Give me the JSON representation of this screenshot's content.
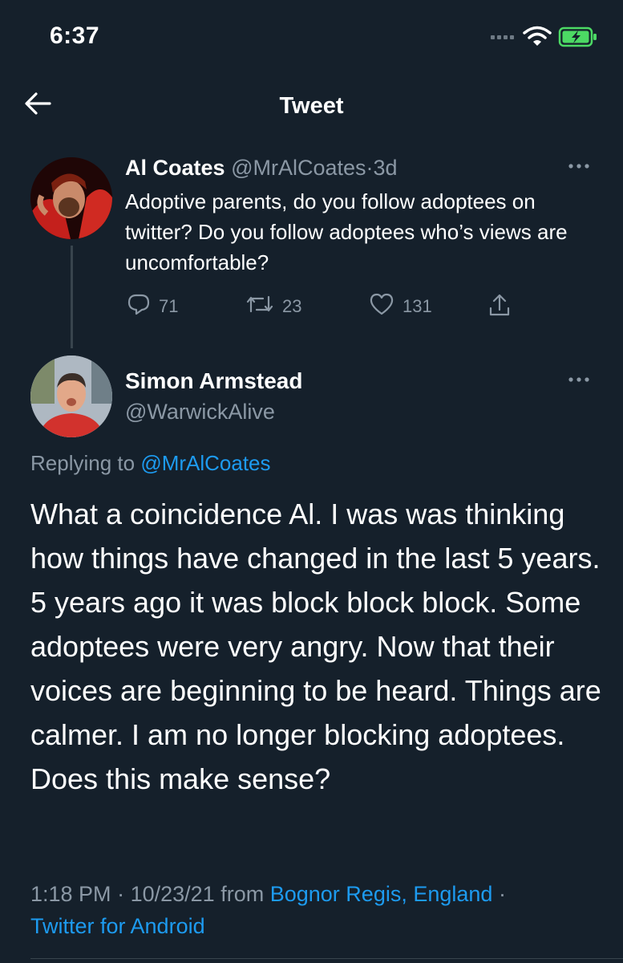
{
  "status_bar": {
    "time": "6:37"
  },
  "header": {
    "title": "Tweet"
  },
  "tweet_parent": {
    "name": "Al Coates",
    "handle": "@MrAlCoates",
    "separator": "·",
    "age": "3d",
    "text": "Adoptive parents, do you follow adoptees on twitter? Do you follow adoptees who’s views are uncomfortable?",
    "replies": "71",
    "retweets": "23",
    "likes": "131"
  },
  "tweet_main": {
    "name": "Simon Armstead",
    "handle": "@WarwickAlive",
    "replying_prefix": "Replying to",
    "replying_handle": "@MrAlCoates",
    "text": "What a coincidence Al. I was was thinking how things have changed in the last 5 years. 5 years ago it was block block block. Some adoptees were very angry. Now that their voices are beginning to be heard. Things are calmer. I am no longer blocking adoptees. Does this make sense?",
    "time": "1:18 PM",
    "date": "10/23/21",
    "from_word": "from",
    "location": "Bognor Regis, England",
    "separator": "·",
    "client": "Twitter for Android"
  },
  "colors": {
    "background": "#15202b",
    "link": "#1d9bf0",
    "muted": "#8b98a5",
    "battery": "#4cd964"
  },
  "icons": [
    "back-arrow-icon",
    "signal-icon",
    "wifi-icon",
    "battery-charging-icon",
    "more-icon",
    "reply-icon",
    "retweet-icon",
    "like-icon",
    "share-icon"
  ]
}
